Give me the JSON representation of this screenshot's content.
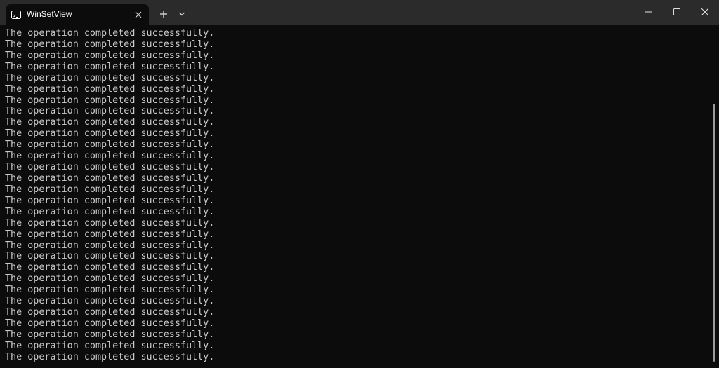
{
  "window": {
    "tab_title": "WinSetView",
    "tab_icon": "terminal-icon"
  },
  "titlebar": {
    "new_tab_icon": "plus-icon",
    "dropdown_icon": "chevron-down-icon",
    "close_tab_icon": "close-icon",
    "minimize_icon": "minimize-icon",
    "maximize_icon": "maximize-icon",
    "close_window_icon": "close-icon"
  },
  "console": {
    "lines": [
      "The operation completed successfully.",
      "The operation completed successfully.",
      "The operation completed successfully.",
      "The operation completed successfully.",
      "The operation completed successfully.",
      "The operation completed successfully.",
      "The operation completed successfully.",
      "The operation completed successfully.",
      "The operation completed successfully.",
      "The operation completed successfully.",
      "The operation completed successfully.",
      "The operation completed successfully.",
      "The operation completed successfully.",
      "The operation completed successfully.",
      "The operation completed successfully.",
      "The operation completed successfully.",
      "The operation completed successfully.",
      "The operation completed successfully.",
      "The operation completed successfully.",
      "The operation completed successfully.",
      "The operation completed successfully.",
      "The operation completed successfully.",
      "The operation completed successfully.",
      "The operation completed successfully.",
      "The operation completed successfully.",
      "The operation completed successfully.",
      "The operation completed successfully.",
      "The operation completed successfully.",
      "The operation completed successfully.",
      "The operation completed successfully."
    ]
  },
  "colors": {
    "background": "#0c0c0c",
    "titlebar": "#2b2b2b",
    "text": "#cccccc"
  }
}
